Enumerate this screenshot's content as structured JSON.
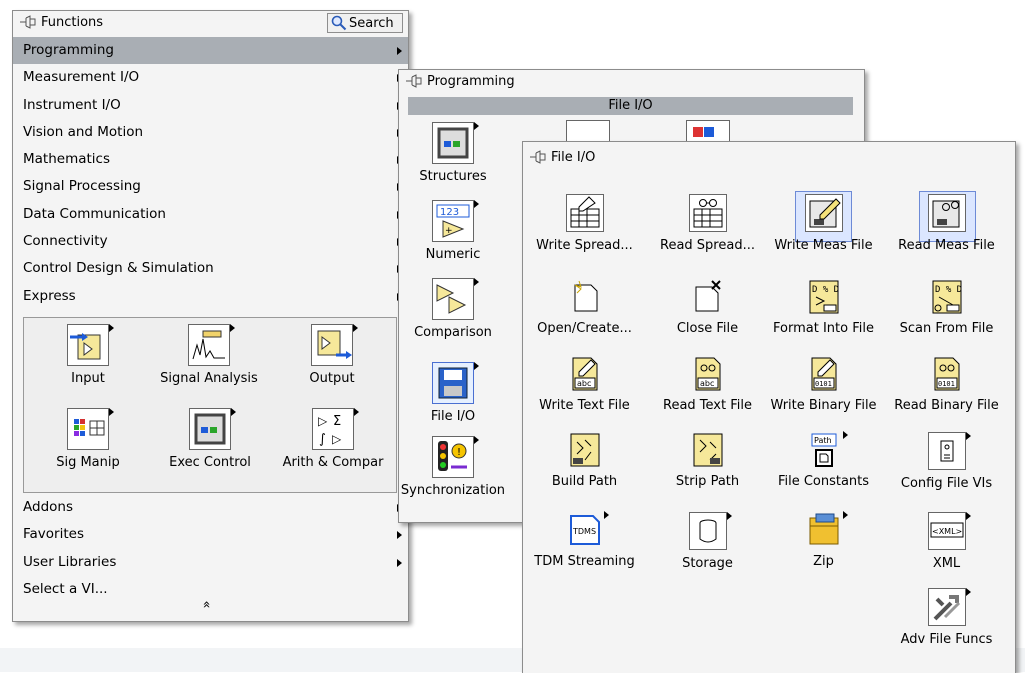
{
  "functions_palette": {
    "title": "Functions",
    "search_label": "Search",
    "menu_items": [
      {
        "label": "Programming",
        "has_submenu": true,
        "selected": true
      },
      {
        "label": "Measurement I/O",
        "has_submenu": true
      },
      {
        "label": "Instrument I/O",
        "has_submenu": true
      },
      {
        "label": "Vision and Motion",
        "has_submenu": true
      },
      {
        "label": "Mathematics",
        "has_submenu": true
      },
      {
        "label": "Signal Processing",
        "has_submenu": true
      },
      {
        "label": "Data Communication",
        "has_submenu": true
      },
      {
        "label": "Connectivity",
        "has_submenu": true
      },
      {
        "label": "Control Design & Simulation",
        "has_submenu": true
      },
      {
        "label": "Express",
        "has_submenu": true
      }
    ],
    "express_icons": [
      {
        "label": "Input",
        "icon": "input-icon"
      },
      {
        "label": "Signal Analysis",
        "icon": "signal-analysis-icon"
      },
      {
        "label": "Output",
        "icon": "output-icon"
      },
      {
        "label": "Sig Manip",
        "icon": "sig-manip-icon"
      },
      {
        "label": "Exec Control",
        "icon": "exec-control-icon"
      },
      {
        "label": "Arith & Compar",
        "icon": "arith-compar-icon"
      }
    ],
    "lower_items": [
      {
        "label": "Addons",
        "has_submenu": true
      },
      {
        "label": "Favorites",
        "has_submenu": true
      },
      {
        "label": "User Libraries",
        "has_submenu": true
      },
      {
        "label": "Select a VI...",
        "has_submenu": false
      }
    ],
    "collapse_glyph": "»"
  },
  "programming_palette": {
    "title": "Programming",
    "current_sub": "File I/O",
    "items": [
      {
        "label": "Structures",
        "icon": "structures-icon"
      },
      {
        "label": "Numeric",
        "icon": "numeric-icon"
      },
      {
        "label": "Comparison",
        "icon": "comparison-icon"
      },
      {
        "label": "File I/O",
        "icon": "file-io-icon"
      },
      {
        "label": "Synchronization",
        "icon": "synchronization-icon"
      }
    ],
    "numeric_glyph": "123"
  },
  "fileio_palette": {
    "title": "File I/O",
    "items": [
      {
        "label": "Write Spread...",
        "icon": "write-spreadsheet-icon"
      },
      {
        "label": "Read Spread...",
        "icon": "read-spreadsheet-icon"
      },
      {
        "label": "Write Meas File",
        "icon": "write-meas-file-icon",
        "highlighted": true
      },
      {
        "label": "Read Meas File",
        "icon": "read-meas-file-icon",
        "highlighted": true
      },
      {
        "label": "Open/Create...",
        "icon": "open-create-icon"
      },
      {
        "label": "Close File",
        "icon": "close-file-icon"
      },
      {
        "label": "Format Into File",
        "icon": "format-into-file-icon"
      },
      {
        "label": "Scan From File",
        "icon": "scan-from-file-icon"
      },
      {
        "label": "Write Text File",
        "icon": "write-text-file-icon"
      },
      {
        "label": "Read Text File",
        "icon": "read-text-file-icon"
      },
      {
        "label": "Write Binary File",
        "icon": "write-binary-file-icon"
      },
      {
        "label": "Read Binary File",
        "icon": "read-binary-file-icon"
      },
      {
        "label": "Build Path",
        "icon": "build-path-icon"
      },
      {
        "label": "Strip Path",
        "icon": "strip-path-icon"
      },
      {
        "label": "File Constants",
        "icon": "file-constants-icon"
      },
      {
        "label": "Config File VIs",
        "icon": "config-file-icon"
      },
      {
        "label": "TDM Streaming",
        "icon": "tdm-streaming-icon"
      },
      {
        "label": "Storage",
        "icon": "storage-icon"
      },
      {
        "label": "Zip",
        "icon": "zip-icon"
      },
      {
        "label": "XML",
        "icon": "xml-icon"
      },
      {
        "label": "Adv File Funcs",
        "icon": "adv-file-funcs-icon"
      }
    ],
    "icon_texts": {
      "abc": "abc",
      "bin": "0101",
      "path": "Path",
      "tdms": "TDMS",
      "xml": "<XML>",
      "pct": "% "
    }
  },
  "colors": {
    "selected_row": "#a9aeb4",
    "highlight_frame": "#6d8ad6",
    "palette_bg": "#f4f4f4"
  }
}
